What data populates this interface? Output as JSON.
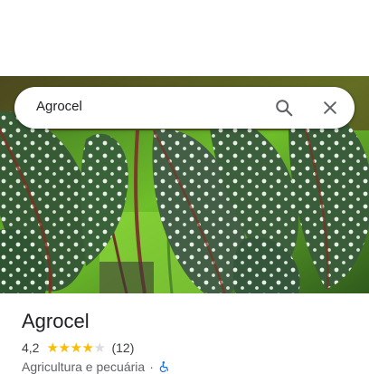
{
  "search": {
    "query": "Agrocel"
  },
  "place": {
    "name": "Agrocel",
    "rating": "4,2",
    "rating_value": 4.2,
    "stars_filled": 4,
    "stars_total": 5,
    "review_count": "(12)",
    "category": "Agricultura e pecuária",
    "separator": "·"
  },
  "icons": {
    "search": "search-icon",
    "close": "close-icon",
    "wheelchair": "wheelchair-accessible-icon"
  },
  "colors": {
    "star": "#fbbc04",
    "star_empty": "#dadce0",
    "accessible": "#1a73e8"
  }
}
